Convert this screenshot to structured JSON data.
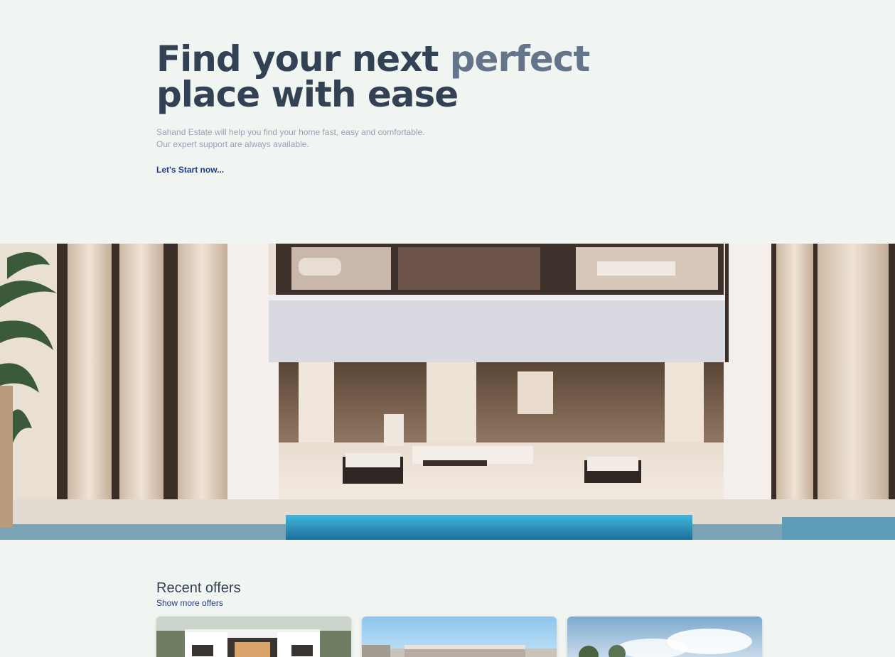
{
  "hero": {
    "title_part1": "Find your next ",
    "title_accent": "perfect",
    "title_part2": "place with ease",
    "description_line1": "Sahand Estate will help you find your home fast, easy and comfortable.",
    "description_line2": "Our expert support are always available.",
    "cta_label": "Let's Start now..."
  },
  "banner": {
    "image": "luxury-villa-exterior-with-pool"
  },
  "offers": {
    "heading": "Recent offers",
    "show_more_label": "Show more offers",
    "cards": [
      {
        "image": "modern-white-villa"
      },
      {
        "image": "modern-building-blue-sky"
      },
      {
        "image": "trees-and-sky"
      }
    ]
  },
  "colors": {
    "page_background": "#f1f5f1",
    "heading": "#334155",
    "accent": "#64748b",
    "muted_text": "#94a3b8",
    "link": "#1e3a8a"
  }
}
